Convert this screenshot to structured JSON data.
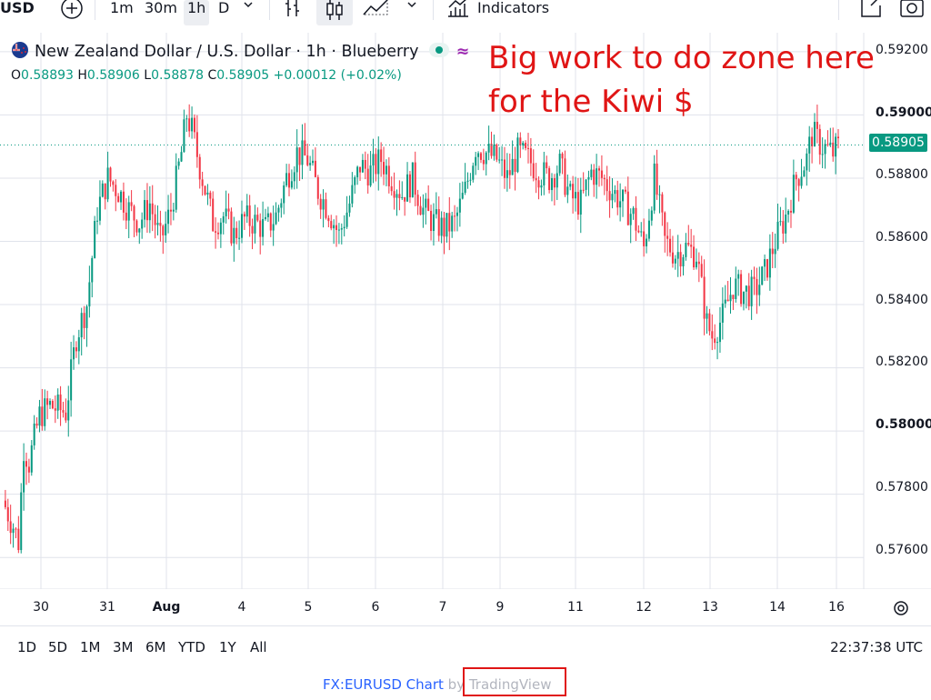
{
  "toolbar": {
    "symbol_fragment": "USD",
    "add_icon": "plus-circle-icon",
    "intervals": [
      "1m",
      "30m",
      "1h",
      "D"
    ],
    "active_interval": "1h",
    "indicators_label": "Indicators"
  },
  "legend": {
    "title": "New Zealand Dollar / U.S. Dollar · 1h · Blueberry",
    "open_label": "O",
    "open": "0.58893",
    "high_label": "H",
    "high": "0.58906",
    "low_label": "L",
    "low": "0.58878",
    "close_label": "C",
    "close": "0.58905",
    "change": "+0.00012 (+0.02%)"
  },
  "annotation": {
    "line1": "Big work to do zone here",
    "line2": "for the Kiwi $"
  },
  "current_price": "0.58905",
  "colors": {
    "up": "#089981",
    "down": "#f23645",
    "grid": "#e0e3eb",
    "annotation": "#e01515",
    "link": "#2962ff"
  },
  "yaxis": {
    "labels": [
      "0.59200",
      "0.59000",
      "0.58800",
      "0.58600",
      "0.58400",
      "0.58200",
      "0.58000",
      "0.57800",
      "0.57600"
    ]
  },
  "xaxis": {
    "labels": [
      "30",
      "31",
      "Aug",
      "4",
      "5",
      "6",
      "7",
      "9",
      "11",
      "12",
      "13",
      "14",
      "16"
    ]
  },
  "range_buttons": [
    "1D",
    "5D",
    "1M",
    "3M",
    "6M",
    "YTD",
    "1Y",
    "All"
  ],
  "clock": "22:37:38 UTC",
  "footer": {
    "link": "FX:EURUSD Chart",
    "by": "by TradingView"
  },
  "chart_data": {
    "type": "candlestick",
    "title": "New Zealand Dollar / U.S. Dollar · 1h · Blueberry",
    "ylim": [
      0.575,
      0.5926
    ],
    "x_labels": [
      "30",
      "31",
      "Aug",
      "4",
      "5",
      "6",
      "7",
      "9",
      "11",
      "12",
      "13",
      "14",
      "16"
    ],
    "close_path": [
      [
        0,
        0.5778
      ],
      [
        4,
        0.577
      ],
      [
        6,
        0.5765
      ],
      [
        8,
        0.5795
      ],
      [
        10,
        0.579
      ],
      [
        14,
        0.5805
      ],
      [
        18,
        0.5808
      ],
      [
        24,
        0.5806
      ],
      [
        28,
        0.583
      ],
      [
        32,
        0.584
      ],
      [
        36,
        0.587
      ],
      [
        40,
        0.588
      ],
      [
        44,
        0.5876
      ],
      [
        48,
        0.587
      ],
      [
        52,
        0.5866
      ],
      [
        56,
        0.5872
      ],
      [
        60,
        0.586
      ],
      [
        64,
        0.587
      ],
      [
        68,
        0.5888
      ],
      [
        70,
        0.59
      ],
      [
        72,
        0.5895
      ],
      [
        76,
        0.588
      ],
      [
        80,
        0.5866
      ],
      [
        84,
        0.5868
      ],
      [
        88,
        0.5862
      ],
      [
        92,
        0.5867
      ],
      [
        96,
        0.5866
      ],
      [
        100,
        0.5864
      ],
      [
        104,
        0.5868
      ],
      [
        108,
        0.588
      ],
      [
        112,
        0.5888
      ],
      [
        116,
        0.5886
      ],
      [
        120,
        0.5876
      ],
      [
        124,
        0.587
      ],
      [
        128,
        0.5862
      ],
      [
        132,
        0.5872
      ],
      [
        136,
        0.5884
      ],
      [
        140,
        0.5882
      ],
      [
        144,
        0.5886
      ],
      [
        148,
        0.588
      ],
      [
        152,
        0.5875
      ],
      [
        156,
        0.588
      ],
      [
        160,
        0.587
      ],
      [
        164,
        0.5866
      ],
      [
        168,
        0.5864
      ],
      [
        172,
        0.5866
      ],
      [
        176,
        0.5876
      ],
      [
        180,
        0.589
      ],
      [
        184,
        0.5888
      ],
      [
        188,
        0.5886
      ],
      [
        192,
        0.588
      ],
      [
        196,
        0.5888
      ],
      [
        200,
        0.5886
      ],
      [
        204,
        0.5882
      ],
      [
        208,
        0.588
      ],
      [
        212,
        0.5884
      ],
      [
        216,
        0.5874
      ],
      [
        220,
        0.5872
      ],
      [
        224,
        0.5882
      ],
      [
        228,
        0.588
      ],
      [
        232,
        0.5876
      ],
      [
        236,
        0.5872
      ],
      [
        240,
        0.5868
      ],
      [
        244,
        0.5858
      ],
      [
        248,
        0.588
      ],
      [
        252,
        0.586
      ],
      [
        256,
        0.5856
      ],
      [
        260,
        0.5858
      ],
      [
        264,
        0.5856
      ],
      [
        268,
        0.5834
      ],
      [
        270,
        0.583
      ],
      [
        274,
        0.5836
      ],
      [
        278,
        0.5846
      ],
      [
        282,
        0.5844
      ],
      [
        286,
        0.5844
      ],
      [
        290,
        0.585
      ],
      [
        294,
        0.586
      ],
      [
        298,
        0.5868
      ],
      [
        302,
        0.588
      ],
      [
        306,
        0.5886
      ],
      [
        308,
        0.5894
      ],
      [
        312,
        0.589
      ],
      [
        316,
        0.5888
      ],
      [
        318,
        0.589
      ]
    ]
  }
}
